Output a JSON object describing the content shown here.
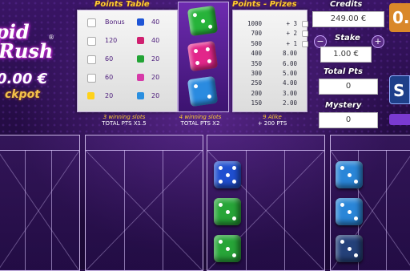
{
  "logo": {
    "line1": "pid",
    "line2": "Rush",
    "reg": "®"
  },
  "jackpot": {
    "amount": "0.00 €",
    "label": "ckpot"
  },
  "points_table": {
    "title": "Points Table",
    "rows": [
      {
        "left_label": "Bonus",
        "left_color": "white",
        "right_value": "40",
        "right_color": "#1f55d6"
      },
      {
        "left_label": "120",
        "left_color": "white",
        "right_value": "40",
        "right_color": "#d02070"
      },
      {
        "left_label": "60",
        "left_color": "white",
        "right_value": "20",
        "right_color": "#23a436"
      },
      {
        "left_label": "60",
        "left_color": "white",
        "right_value": "20",
        "right_color": "#d63aa8"
      },
      {
        "left_label": "20",
        "left_color": "#ffd21a",
        "right_value": "20",
        "right_color": "#2a8fe0"
      }
    ]
  },
  "featured_dice": [
    {
      "name": "green-die",
      "color": "#27b33a"
    },
    {
      "name": "pink-die",
      "color": "#e2268a"
    },
    {
      "name": "blue-die",
      "color": "#2a8be0"
    }
  ],
  "points_prizes": {
    "title": "Points - Prizes",
    "rows": [
      {
        "points": "1000",
        "prize": "+ 3"
      },
      {
        "points": "700",
        "prize": "+ 2"
      },
      {
        "points": "500",
        "prize": "+ 1"
      },
      {
        "points": "400",
        "prize": "8.00"
      },
      {
        "points": "350",
        "prize": "6.00"
      },
      {
        "points": "300",
        "prize": "5.00"
      },
      {
        "points": "250",
        "prize": "4.00"
      },
      {
        "points": "200",
        "prize": "3.00"
      },
      {
        "points": "150",
        "prize": "2.00"
      }
    ]
  },
  "credits": {
    "label": "Credits",
    "value": "249.00 €"
  },
  "stake": {
    "label": "Stake",
    "value": "1.00 €",
    "minus": "−",
    "plus": "+"
  },
  "total_pts": {
    "label": "Total Pts",
    "value": "0"
  },
  "mystery": {
    "label": "Mystery",
    "value": "0"
  },
  "right_edge": {
    "top_text": "0.",
    "start_label": "S"
  },
  "bonus_stats": [
    {
      "line1": "3 winning slots",
      "line2": "TOTAL PTS X1.5"
    },
    {
      "line1": "4 winning slots",
      "line2": "TOTAL PTS X2"
    },
    {
      "line1": "9 Alike",
      "line2": "+ 200 PTS"
    }
  ],
  "colors": {
    "accent": "#ffcc33",
    "bg": "#2a0f4a",
    "panel": "#f0f0f0"
  }
}
